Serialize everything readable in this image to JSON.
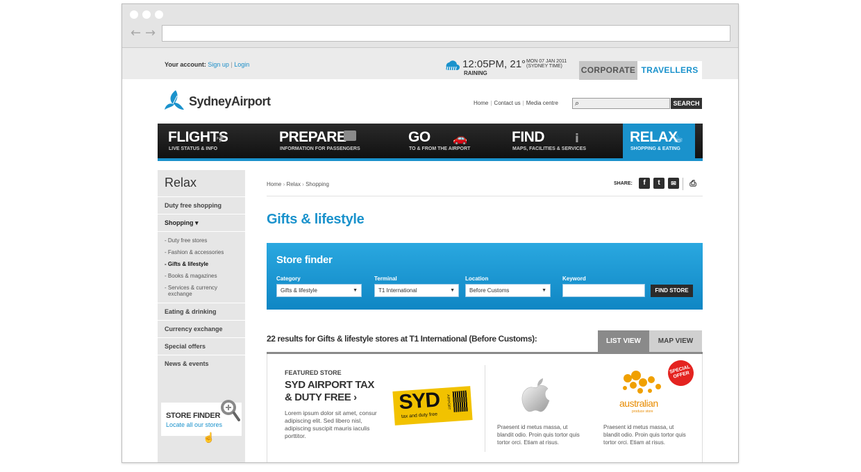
{
  "header": {
    "account_label": "Your account:",
    "sign_up": "Sign up",
    "separator": "|",
    "login": "Login",
    "time": "12:05PM, 21°",
    "weather": "RAINING",
    "date": "MON 07 JAN 2011",
    "timezone": "(SYDNEY TIME)",
    "tab_corporate": "CORPORATE",
    "tab_travellers": "TRAVELLERS"
  },
  "logo": {
    "name": "SydneyAirport"
  },
  "toplinks": {
    "home": "Home",
    "contact": "Contact us",
    "media": "Media centre"
  },
  "search": {
    "button": "SEARCH",
    "icon": "search-icon"
  },
  "mainnav": [
    {
      "title": "FLIGHTS",
      "sub": "LIVE STATUS & INFO",
      "icon": "plane-icon"
    },
    {
      "title": "PREPARE",
      "sub": "INFORMATION FOR PASSENGERS",
      "icon": "suitcase-icon"
    },
    {
      "title": "GO",
      "sub": "TO & FROM THE AIRPORT",
      "icon": "car-icon"
    },
    {
      "title": "FIND",
      "sub": "MAPS, FACILITIES & SERVICES",
      "icon": "info-icon"
    },
    {
      "title": "RELAX",
      "sub": "SHOPPING & EATING",
      "icon": "coffee-icon"
    }
  ],
  "sidebar": {
    "title": "Relax",
    "items": [
      "Duty free shopping",
      "Shopping ▾",
      "Eating & drinking",
      "Currency exchange",
      "Special offers",
      "News & events"
    ],
    "subitems": [
      "- Duty free stores",
      "- Fashion & accessories",
      "- Gifts & lifestyle",
      "- Books & magazines",
      "- Services & currency",
      "exchange"
    ],
    "store_finder_title": "STORE FINDER",
    "store_finder_link": "Locate all our stores"
  },
  "breadcrumb": {
    "home": "Home",
    "relax": "Relax",
    "shopping": "Shopping"
  },
  "share": {
    "label": "SHARE:",
    "facebook": "f",
    "twitter": "t"
  },
  "page_title": "Gifts & lifestyle",
  "finder": {
    "title": "Store finder",
    "category_label": "Category",
    "category_value": "Gifts & lifestyle",
    "terminal_label": "Terminal",
    "terminal_value": "T1 International",
    "location_label": "Location",
    "location_value": "Before Customs",
    "keyword_label": "Keyword",
    "keyword_value": "",
    "button": "FIND STORE"
  },
  "results": {
    "text": "22 results for Gifts & lifestyle stores at T1 International (Before Customs):",
    "tab_list": "LIST VIEW",
    "tab_map": "MAP VIEW"
  },
  "cards": {
    "featured_label": "FEATURED STORE",
    "featured_name_1": "SYD AIRPORT TAX",
    "featured_name_2": "& DUTY FREE ›",
    "featured_desc": "Lorem ipsum dolor sit amet, consur adipiscing elit. Sed libero nisl, adipiscing suscipit mauris iaculis porttitor.",
    "syd_logo_text": "SYD",
    "syd_logo_sub": "tax and duty free",
    "syd_logo_airport": "AIRPORT",
    "apple_desc": "Praesent id metus massa, ut blandit odio. Proin quis tortor quis tortor orci. Etiam at risus.",
    "aus_logo_text": "australian",
    "aus_logo_sub": "produce store",
    "aus_desc": "Praesent id metus massa, ut blandit odio. Proin quis tortor quis tortor orci. Etiam at risus.",
    "special_badge_1": "SPECIAL",
    "special_badge_2": "OFFER"
  },
  "colors": {
    "accent": "#1a92cc",
    "nav_bg": "#1c1c1c",
    "badge": "#e42320",
    "syd_yellow": "#f2c200",
    "aus_orange": "#e88b00"
  }
}
